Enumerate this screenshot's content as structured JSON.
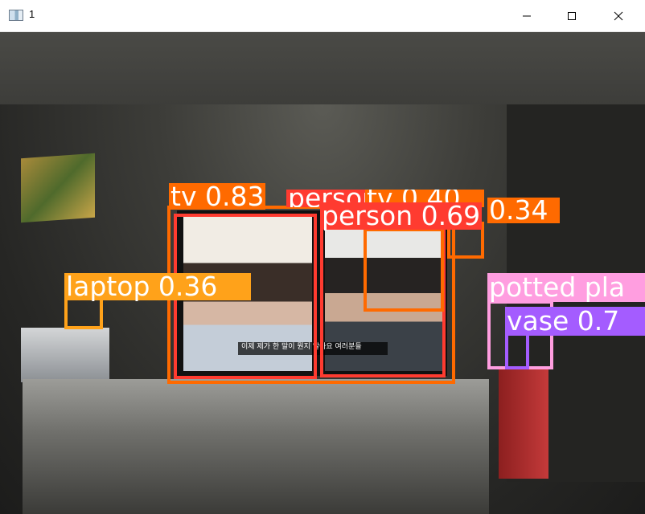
{
  "window": {
    "title": "1"
  },
  "titlebar_buttons": {
    "minimize": "minimize-icon",
    "maximize": "maximize-icon",
    "close": "close-icon"
  },
  "colors": {
    "tv": "#ff6a00",
    "person": "#ff3b30",
    "laptop": "#ffa21a",
    "potted_plant": "#ff9ee0",
    "vase": "#a45cff"
  },
  "detections": [
    {
      "text": "tv 0.83",
      "class": "tv"
    },
    {
      "text": "person 0.36",
      "class": "person"
    },
    {
      "text": "tv 0.40",
      "class": "tv"
    },
    {
      "text": "0.34",
      "class": "tv"
    },
    {
      "text": "person 0.69",
      "class": "person"
    },
    {
      "text": "laptop 0.36",
      "class": "laptop"
    },
    {
      "text": "potted pla",
      "class": "potted_plant"
    },
    {
      "text": "vase 0.7",
      "class": "vase"
    }
  ],
  "subtitle": "이제 제가 한 말이 뭔지 알아요 여러분들"
}
